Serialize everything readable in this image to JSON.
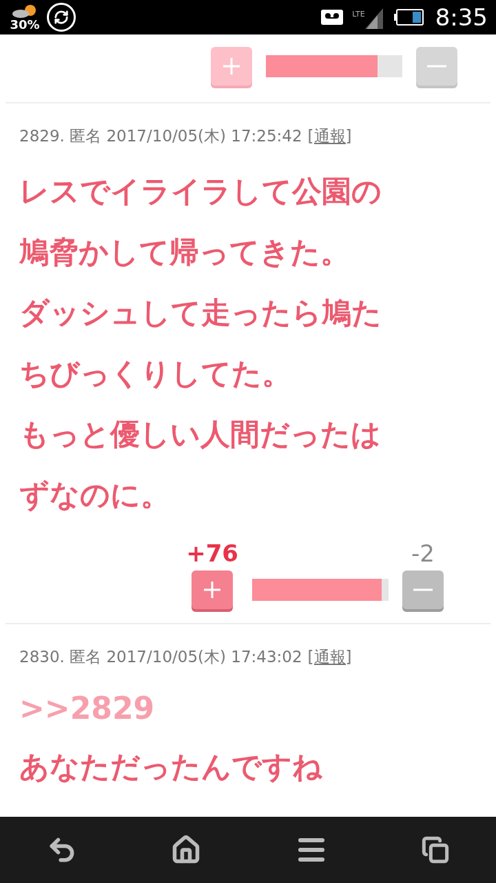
{
  "status_bar": {
    "weather_percent": "30%",
    "network": "LTE",
    "time": "8:35"
  },
  "top_votes": {
    "level": 0.82,
    "dimmed": true
  },
  "posts": [
    {
      "header": "2829. 匿名 2017/10/05(木) 17:25:42",
      "report": "[通報]",
      "body": [
        {
          "kind": "text",
          "text": "レスでイライラして公園の"
        },
        {
          "kind": "text",
          "text": "鳩脅かして帰ってきた。"
        },
        {
          "kind": "text",
          "text": "ダッシュして走ったら鳩た"
        },
        {
          "kind": "text",
          "text": "ちびっくりしてた。"
        },
        {
          "kind": "text",
          "text": "もっと優しい人間だったは"
        },
        {
          "kind": "text",
          "text": "ずなのに。"
        }
      ],
      "votes": {
        "plus": "+76",
        "minus": "-2",
        "level": 0.95,
        "dimmed": false
      }
    },
    {
      "header": "2830. 匿名 2017/10/05(木) 17:43:02",
      "report": "[通報]",
      "body": [
        {
          "kind": "quote",
          "text": ">>2829"
        },
        {
          "kind": "text",
          "text": "あなただったんですね"
        }
      ]
    }
  ]
}
